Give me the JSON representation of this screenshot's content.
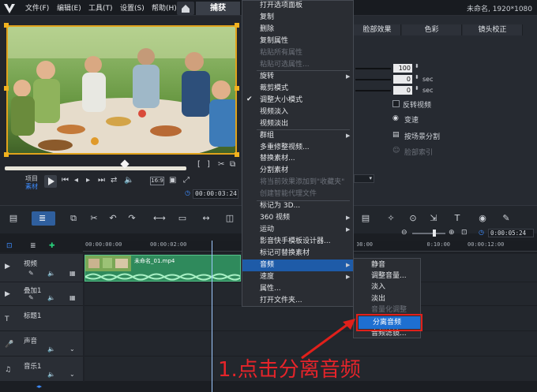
{
  "menubar": {
    "items": [
      "文件(F)",
      "编辑(E)",
      "工具(T)",
      "设置(S)",
      "帮助(H)"
    ],
    "capture_tab": "捕获",
    "project_info": "未命名, 1920*1080"
  },
  "preview": {
    "project_label": "项目",
    "clip_label": "素材",
    "timecode": "00:00:03:24",
    "aspect": "16:9"
  },
  "options": {
    "tabs": [
      "脸部效果",
      "色彩",
      "镜头校正"
    ],
    "values": [
      "100",
      "0",
      "0"
    ],
    "sec_label": "sec",
    "reverse_label": "反转视频",
    "speed_label": "变速",
    "split_scene_label": "按场景分割",
    "face_index_label": "脸部索引"
  },
  "context_menu": {
    "items": [
      {
        "label": "打开选项面板",
        "disabled": false,
        "submenu": false
      },
      {
        "label": "复制",
        "disabled": false,
        "submenu": false
      },
      {
        "label": "删除",
        "disabled": false,
        "submenu": false
      },
      {
        "label": "复制属性",
        "disabled": false,
        "submenu": false
      },
      {
        "label": "粘贴所有属性",
        "disabled": true,
        "submenu": false
      },
      {
        "label": "粘贴可选属性...",
        "disabled": true,
        "submenu": false
      },
      {
        "label": "旋转",
        "disabled": false,
        "submenu": true
      },
      {
        "label": "裁剪模式",
        "disabled": false,
        "submenu": false
      },
      {
        "label": "调整大小模式",
        "disabled": false,
        "submenu": false,
        "checked": true
      },
      {
        "label": "视频淡入",
        "disabled": false,
        "submenu": false
      },
      {
        "label": "视频淡出",
        "disabled": false,
        "submenu": false
      },
      {
        "label": "群组",
        "disabled": false,
        "submenu": true
      },
      {
        "label": "多重修整视频...",
        "disabled": false,
        "submenu": false
      },
      {
        "label": "替换素材...",
        "disabled": false,
        "submenu": false
      },
      {
        "label": "分割素材",
        "disabled": false,
        "submenu": false
      },
      {
        "label": "将当前效果添加到\"收藏夹\"",
        "disabled": true,
        "submenu": false
      },
      {
        "label": "创建智能代理文件",
        "disabled": true,
        "submenu": false
      },
      {
        "label": "标记为 3D...",
        "disabled": false,
        "submenu": false
      },
      {
        "label": "360 视频",
        "disabled": false,
        "submenu": true
      },
      {
        "label": "运动",
        "disabled": false,
        "submenu": true
      },
      {
        "label": "影音快手模板设计器...",
        "disabled": false,
        "submenu": false
      },
      {
        "label": "标记可替换素材",
        "disabled": false,
        "submenu": false
      },
      {
        "label": "音频",
        "disabled": false,
        "submenu": true,
        "highlighted": true
      },
      {
        "label": "速度",
        "disabled": false,
        "submenu": true
      },
      {
        "label": "属性...",
        "disabled": false,
        "submenu": false
      },
      {
        "label": "打开文件夹...",
        "disabled": false,
        "submenu": false
      }
    ]
  },
  "audio_submenu": {
    "items": [
      {
        "label": "静音",
        "disabled": false
      },
      {
        "label": "调整音量...",
        "disabled": false
      },
      {
        "label": "淡入",
        "disabled": false
      },
      {
        "label": "淡出",
        "disabled": false
      },
      {
        "label": "音量化调整",
        "disabled": true
      },
      {
        "label": "分离音频",
        "disabled": false,
        "highlighted": true
      },
      {
        "label": "音频滤镜...",
        "disabled": false
      }
    ]
  },
  "timeline": {
    "ruler": [
      "00:00:00:00",
      "00:00:02:00",
      "00:00:08:00",
      "00:00:10:00",
      "00:00:12:00"
    ],
    "zoom_timecode": "0:00:05:24",
    "tracks": [
      "视频",
      "叠加1",
      "标题1",
      "声音",
      "音乐1"
    ],
    "clip_name": "未命名_01.mp4"
  },
  "annotation": "1.点击分离音频",
  "colors": {
    "accent_blue": "#1e6fd1",
    "highlight_red": "#e0201b",
    "clip_green": "#2f8a5c",
    "frame_orange": "#e0a21b"
  }
}
